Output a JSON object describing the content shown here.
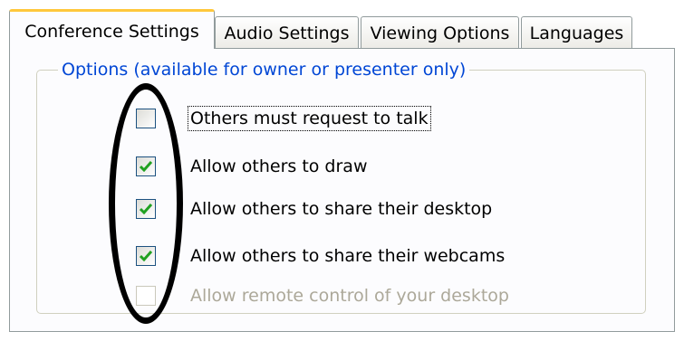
{
  "tabs": [
    {
      "label": "Conference Settings",
      "active": true
    },
    {
      "label": "Audio Settings",
      "active": false
    },
    {
      "label": "Viewing Options",
      "active": false
    },
    {
      "label": "Languages",
      "active": false
    }
  ],
  "group": {
    "title": "Options (available for owner or presenter only)"
  },
  "options": [
    {
      "label": "Others must request to talk",
      "checked": false,
      "enabled": true
    },
    {
      "label": "Allow others to draw",
      "checked": true,
      "enabled": true
    },
    {
      "label": "Allow others to share their desktop",
      "checked": true,
      "enabled": true
    },
    {
      "label": "Allow others to share their webcams",
      "checked": true,
      "enabled": true
    },
    {
      "label": "Allow remote control of your desktop",
      "checked": false,
      "enabled": false
    }
  ],
  "colors": {
    "group_title": "#0046d5",
    "checkmark": "#21a121",
    "active_tab_accent": "#ffc83c",
    "annotation": "#000000"
  },
  "icons": {
    "check": "checkmark-icon"
  }
}
